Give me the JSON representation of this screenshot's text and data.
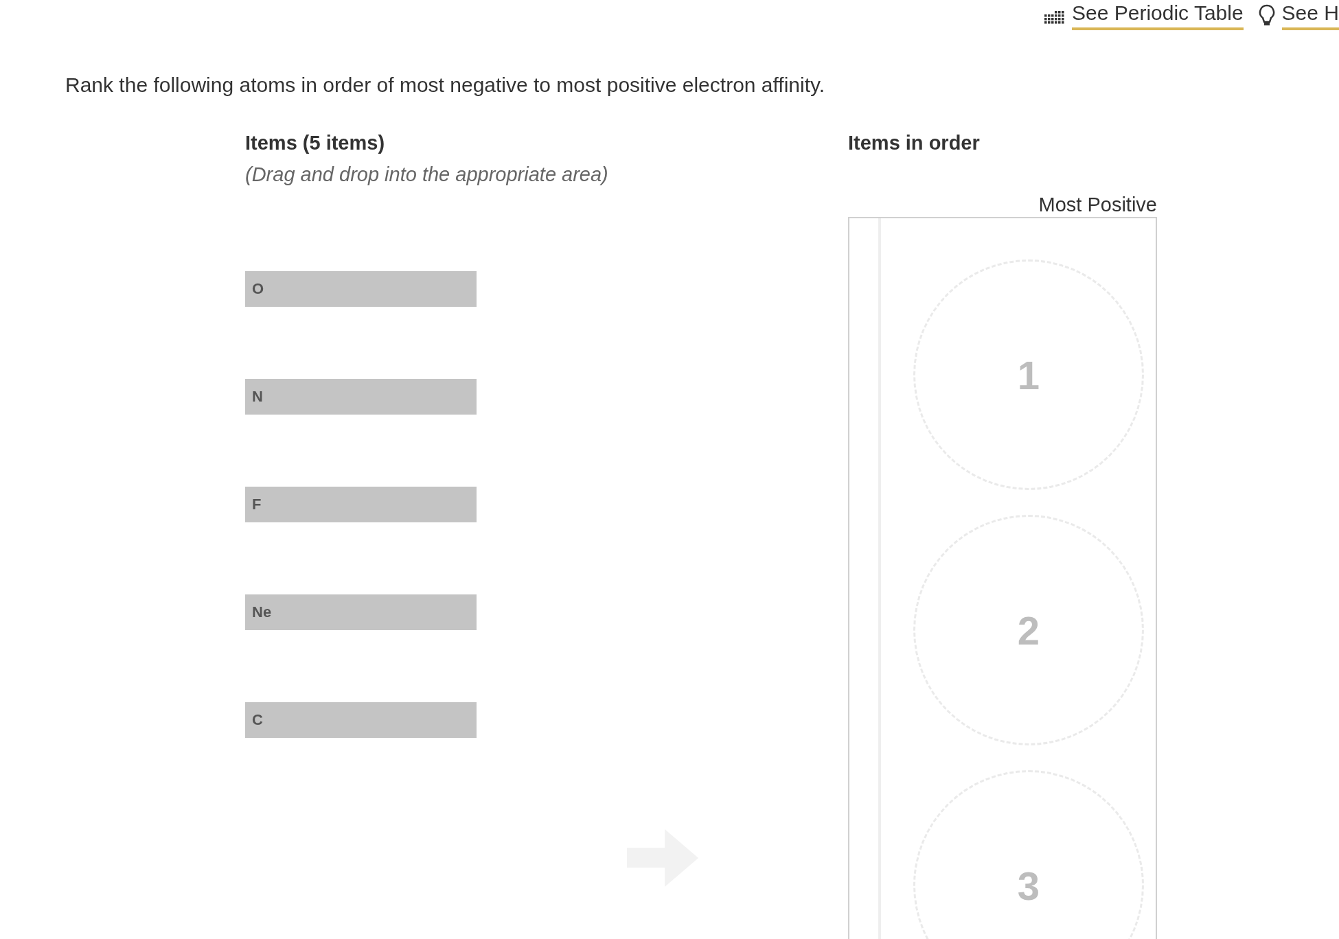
{
  "toolbar_links": [
    {
      "kind": "periodic",
      "label": "See Periodic Table"
    },
    {
      "kind": "hint",
      "label": "See H"
    }
  ],
  "question": "Rank the following atoms in order of most negative to most positive electron affinity.",
  "items_panel": {
    "title": "Items (5 items)",
    "instruction": "(Drag and drop into the appropriate area)",
    "items": [
      "O",
      "N",
      "F",
      "Ne",
      "C"
    ]
  },
  "order_panel": {
    "title": "Items in order",
    "end_label": "Most Positive",
    "slots": [
      "1",
      "2",
      "3"
    ]
  }
}
